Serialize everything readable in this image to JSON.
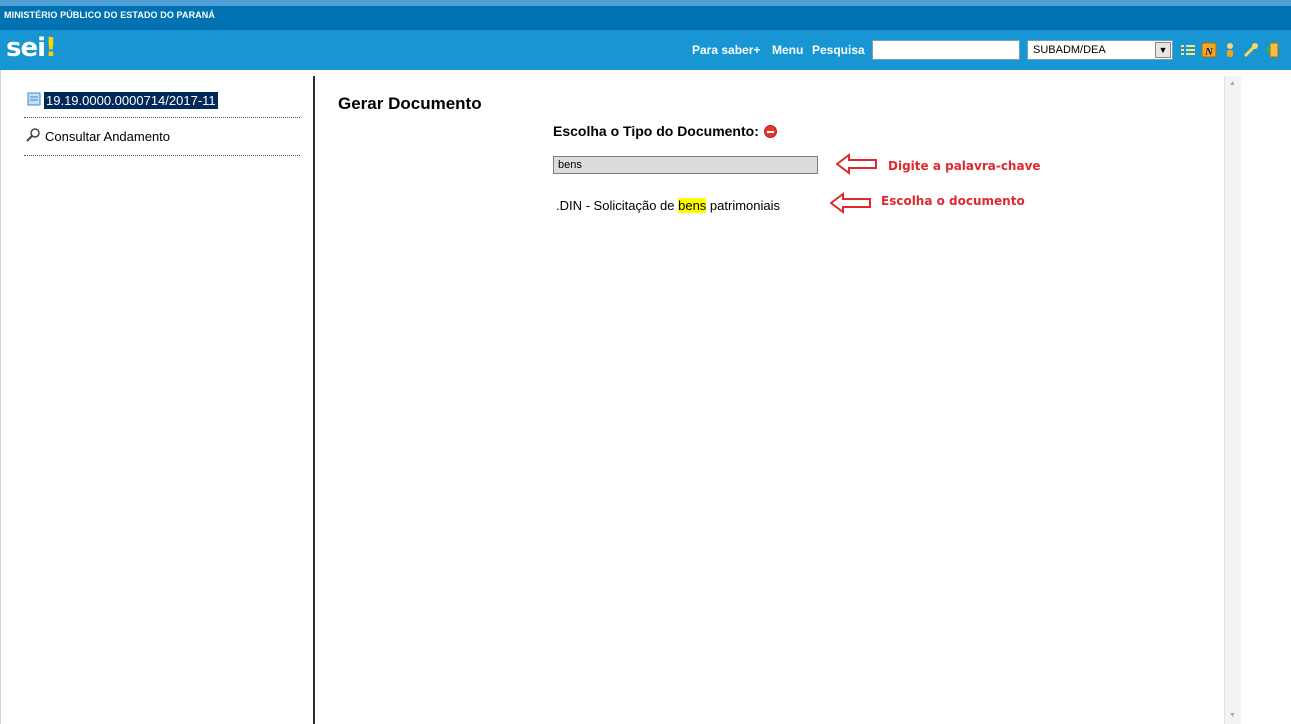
{
  "header": {
    "org_title": "MINISTÉRIO PÚBLICO DO ESTADO DO PARANÁ",
    "logo_text": "sei",
    "logo_bang": "!",
    "nav": {
      "para_saber": "Para saber+",
      "menu": "Menu",
      "pesquisa": "Pesquisa"
    },
    "search_value": "",
    "unit_selected": "SUBADM/DEA",
    "icons": [
      "list-icon",
      "notepad-icon",
      "user-icon",
      "wrench-icon",
      "logout-icon"
    ],
    "colors": {
      "org_bar": "#0072b1",
      "nav_bar": "#1796d3",
      "logo_accent": "#ffd200"
    }
  },
  "sidebar": {
    "process_number": "19.19.0000.0000714/2017-11",
    "consult_label": "Consultar Andamento"
  },
  "main": {
    "title": "Gerar Documento",
    "subtitle": "Escolha o Tipo do Documento:",
    "filter_value": "bens",
    "result": {
      "prefix": ".DIN - Solicitação de ",
      "highlight": "bens",
      "suffix": " patrimoniais"
    }
  },
  "annotations": {
    "keyword_hint": "Digite a palavra-chave",
    "choose_hint": "Escolha o documento",
    "color": "#e0282e"
  }
}
